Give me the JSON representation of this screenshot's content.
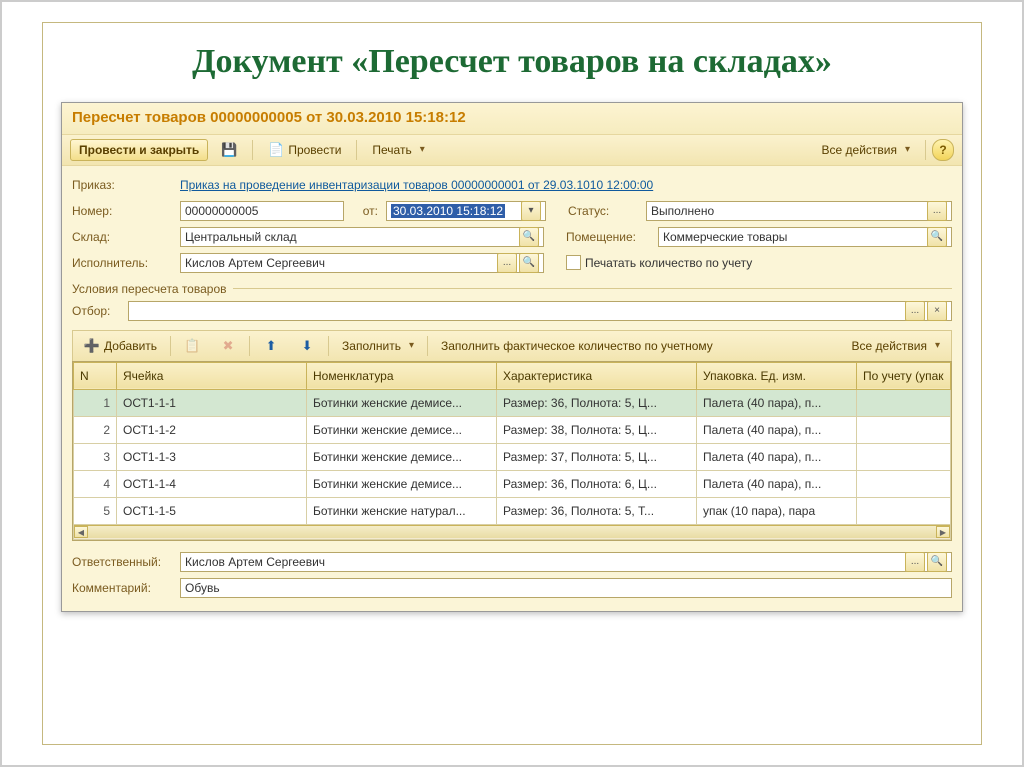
{
  "slide": {
    "title": "Документ «Пересчет товаров на складах»"
  },
  "app": {
    "title": "Пересчет товаров 00000000005 от 30.03.2010 15:18:12"
  },
  "toolbar": {
    "main_button": "Провести и закрыть",
    "post_button": "Провести",
    "print_button": "Печать",
    "all_actions": "Все действия"
  },
  "form": {
    "order_label": "Приказ:",
    "order_link": "Приказ на проведение инвентаризации товаров 00000000001 от 29.03.1010 12:00:00",
    "number_label": "Номер:",
    "number": "00000000005",
    "date_label": "от:",
    "date": "30.03.2010 15:18:12",
    "status_label": "Статус:",
    "status": "Выполнено",
    "warehouse_label": "Склад:",
    "warehouse": "Центральный склад",
    "room_label": "Помещение:",
    "room": "Коммерческие товары",
    "performer_label": "Исполнитель:",
    "performer": "Кислов Артем Сергеевич",
    "print_qty_label": "Печатать количество по учету",
    "conditions_label": "Условия пересчета товаров",
    "filter_label": "Отбор:"
  },
  "table_toolbar": {
    "add": "Добавить",
    "fill": "Заполнить",
    "fill_actual": "Заполнить фактическое количество по учетному",
    "all_actions": "Все действия"
  },
  "cols": {
    "n": "N",
    "cell": "Ячейка",
    "nomen": "Номенклатура",
    "char": "Характеристика",
    "pack": "Упаковка. Ед. изм.",
    "acct": "По учету (упак"
  },
  "rows": {
    "r0": {
      "n": "1",
      "cell": "ОСТ1-1-1",
      "nomen": "Ботинки женские демисе...",
      "char": "Размер: 36, Полнота: 5, Ц...",
      "pack": "Палета (40 пара), п..."
    },
    "r1": {
      "n": "2",
      "cell": "ОСТ1-1-2",
      "nomen": "Ботинки женские демисе...",
      "char": "Размер: 38, Полнота: 5, Ц...",
      "pack": "Палета (40 пара), п..."
    },
    "r2": {
      "n": "3",
      "cell": "ОСТ1-1-3",
      "nomen": "Ботинки женские демисе...",
      "char": "Размер: 37, Полнота: 5, Ц...",
      "pack": "Палета (40 пара), п..."
    },
    "r3": {
      "n": "4",
      "cell": "ОСТ1-1-4",
      "nomen": "Ботинки женские демисе...",
      "char": "Размер: 36, Полнота: 6, Ц...",
      "pack": "Палета (40 пара), п..."
    },
    "r4": {
      "n": "5",
      "cell": "ОСТ1-1-5",
      "nomen": "Ботинки женские натурал...",
      "char": "Размер: 36, Полнота: 5, Т...",
      "pack": "упак (10 пара), пара"
    }
  },
  "footer": {
    "resp_label": "Ответственный:",
    "resp": "Кислов Артем Сергеевич",
    "comment_label": "Комментарий:",
    "comment": "Обувь"
  }
}
